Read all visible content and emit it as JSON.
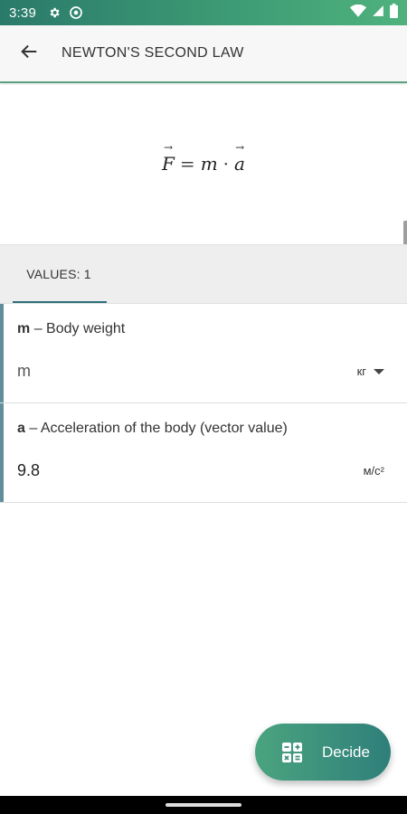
{
  "status_bar": {
    "time": "3:39"
  },
  "app_bar": {
    "title": "NEWTON'S SECOND LAW"
  },
  "formula": {
    "lhs": "F",
    "equals": "=",
    "m": "m",
    "dot": "·",
    "a": "a"
  },
  "tabs": [
    {
      "label": "VALUES: 1",
      "selected": true
    }
  ],
  "params": [
    {
      "symbol": "m",
      "dash": "–",
      "description": "Body weight",
      "value": "m",
      "unit": "кг",
      "has_dropdown": true
    },
    {
      "symbol": "a",
      "dash": "–",
      "description": "Acceleration of the body (vector value)",
      "value": "9.8",
      "unit": "м/с²",
      "has_dropdown": false
    }
  ],
  "fab": {
    "label": "Decide"
  },
  "colors": {
    "status_bar": "#3d9a74",
    "accent": "#2e6f7a",
    "fab": "#3b937c"
  }
}
